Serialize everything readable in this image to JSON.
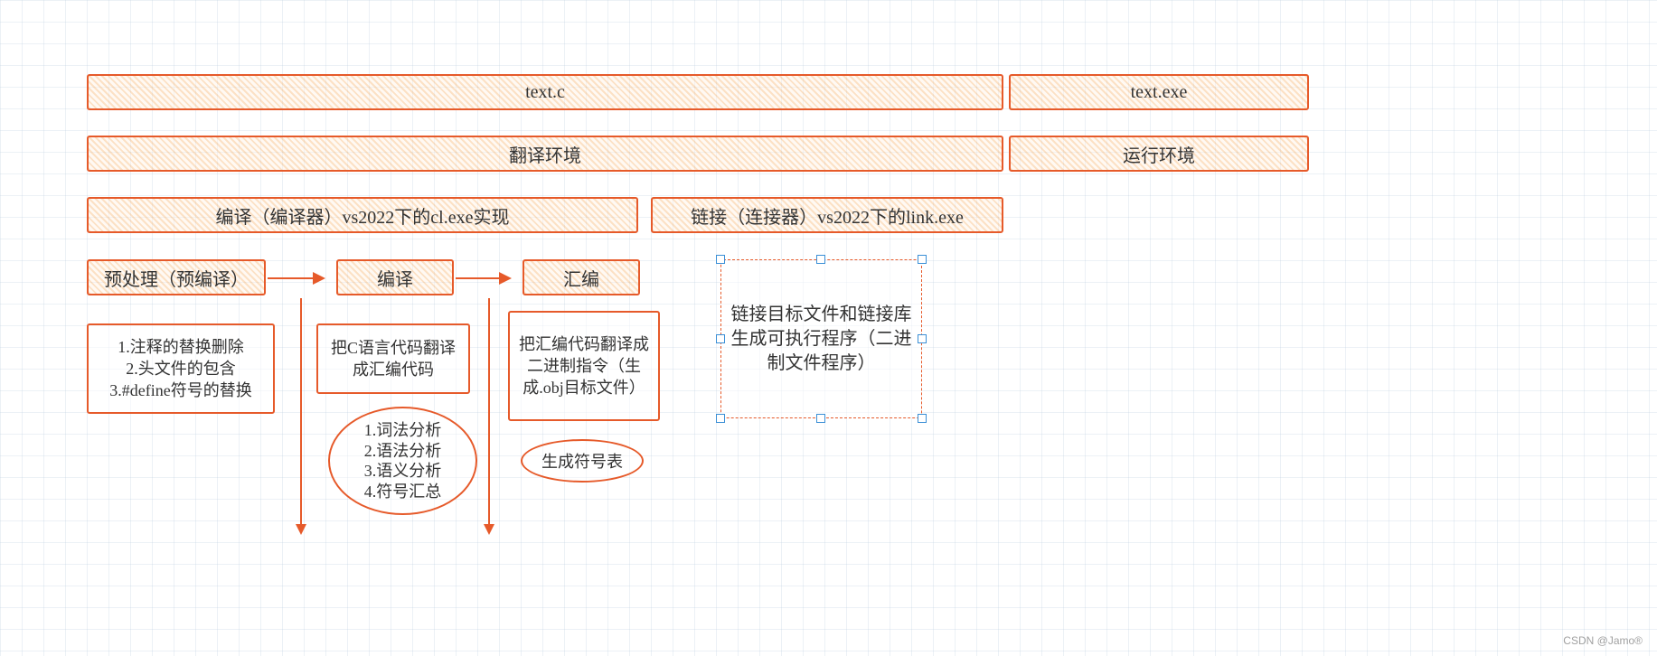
{
  "row1": {
    "left": "text.c",
    "right": "text.exe"
  },
  "row2": {
    "left": "翻译环境",
    "right": "运行环境"
  },
  "row3": {
    "compile": "编译（编译器）vs2022下的cl.exe实现",
    "link": "链接（连接器）vs2022下的link.exe"
  },
  "stage": {
    "preproc": "预处理（预编译）",
    "compile": "编译",
    "asm": "汇编"
  },
  "details": {
    "preproc": "1.注释的替换删除\n2.头文件的包含\n3.#define符号的替换",
    "compile": "把C语言代码翻译成汇编代码",
    "asm": "把汇编代码翻译成二进制指令（生成.obj目标文件）",
    "link": "链接目标文件和链接库生成可执行程序（二进制文件程序）"
  },
  "ellipse": {
    "compile_list": "1.词法分析\n2.语法分析\n3.语义分析\n4.符号汇总",
    "asm_list": "生成符号表"
  },
  "watermark": "CSDN @Jamo®"
}
